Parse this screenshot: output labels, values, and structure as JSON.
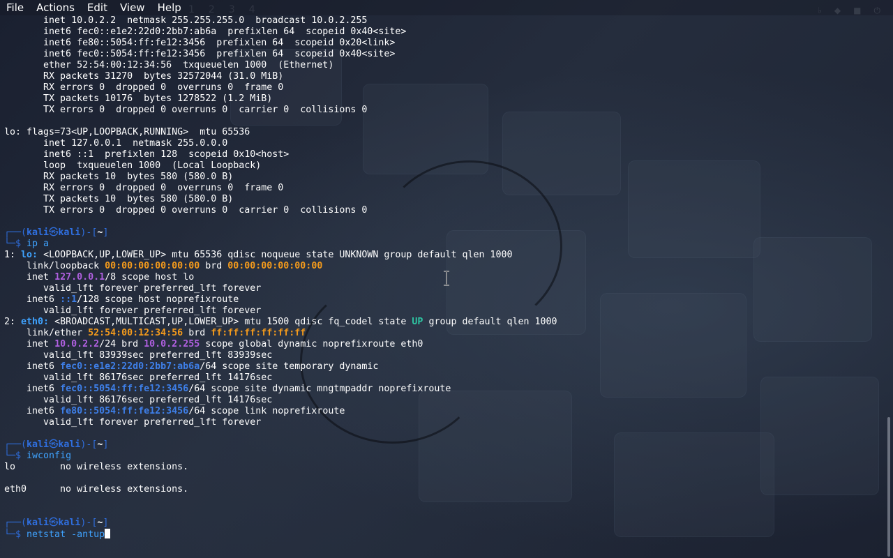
{
  "menubar": {
    "items": [
      "File",
      "Actions",
      "Edit",
      "View",
      "Help"
    ]
  },
  "prompt": {
    "user": "kali",
    "host": "kali",
    "path": "~"
  },
  "terminal": {
    "lines": [
      [
        {
          "t": "       inet 10.0.2.2  netmask 255.255.255.0  broadcast 10.0.2.255"
        }
      ],
      [
        {
          "t": "       inet6 fec0::e1e2:22d0:2bb7:ab6a  prefixlen 64  scopeid 0x40<site>"
        }
      ],
      [
        {
          "t": "       inet6 fe80::5054:ff:fe12:3456  prefixlen 64  scopeid 0x20<link>"
        }
      ],
      [
        {
          "t": "       inet6 fec0::5054:ff:fe12:3456  prefixlen 64  scopeid 0x40<site>"
        }
      ],
      [
        {
          "t": "       ether 52:54:00:12:34:56  txqueuelen 1000  (Ethernet)"
        }
      ],
      [
        {
          "t": "       RX packets 31270  bytes 32572044 (31.0 MiB)"
        }
      ],
      [
        {
          "t": "       RX errors 0  dropped 0  overruns 0  frame 0"
        }
      ],
      [
        {
          "t": "       TX packets 10176  bytes 1278522 (1.2 MiB)"
        }
      ],
      [
        {
          "t": "       TX errors 0  dropped 0 overruns 0  carrier 0  collisions 0"
        }
      ],
      [],
      [
        {
          "t": "lo: flags=73<UP,LOOPBACK,RUNNING>  mtu 65536"
        }
      ],
      [
        {
          "t": "       inet 127.0.0.1  netmask 255.0.0.0"
        }
      ],
      [
        {
          "t": "       inet6 ::1  prefixlen 128  scopeid 0x10<host>"
        }
      ],
      [
        {
          "t": "       loop  txqueuelen 1000  (Local Loopback)"
        }
      ],
      [
        {
          "t": "       RX packets 10  bytes 580 (580.0 B)"
        }
      ],
      [
        {
          "t": "       RX errors 0  dropped 0  overruns 0  frame 0"
        }
      ],
      [
        {
          "t": "       TX packets 10  bytes 580 (580.0 B)"
        }
      ],
      [
        {
          "t": "       TX errors 0  dropped 0 overruns 0  carrier 0  collisions 0"
        }
      ],
      [],
      [
        {
          "prompt": true
        }
      ],
      [
        {
          "t": "└─$ ",
          "c": "c-prompt"
        },
        {
          "t": "ip a",
          "c": "c-cmd"
        }
      ],
      [
        {
          "t": "1: "
        },
        {
          "t": "lo:",
          "c": "c-dev"
        },
        {
          "t": " <LOOPBACK,UP,LOWER_UP> mtu 65536 qdisc noqueue state UNKNOWN group default qlen 1000"
        }
      ],
      [
        {
          "t": "    link/loopback "
        },
        {
          "t": "00:00:00:00:00:00",
          "c": "c-orange"
        },
        {
          "t": " brd "
        },
        {
          "t": "00:00:00:00:00:00",
          "c": "c-orange"
        }
      ],
      [
        {
          "t": "    inet "
        },
        {
          "t": "127.0.0.1",
          "c": "c-purple"
        },
        {
          "t": "/8 scope host lo"
        }
      ],
      [
        {
          "t": "       valid_lft forever preferred_lft forever"
        }
      ],
      [
        {
          "t": "    inet6 "
        },
        {
          "t": "::1",
          "c": "c-blue"
        },
        {
          "t": "/128 scope host noprefixroute"
        }
      ],
      [
        {
          "t": "       valid_lft forever preferred_lft forever"
        }
      ],
      [
        {
          "t": "2: "
        },
        {
          "t": "eth0:",
          "c": "c-dev"
        },
        {
          "t": " <BROADCAST,MULTICAST,UP,LOWER_UP> mtu 1500 qdisc fq_codel state "
        },
        {
          "t": "UP",
          "c": "c-green"
        },
        {
          "t": " group default qlen 1000"
        }
      ],
      [
        {
          "t": "    link/ether "
        },
        {
          "t": "52:54:00:12:34:56",
          "c": "c-orange"
        },
        {
          "t": " brd "
        },
        {
          "t": "ff:ff:ff:ff:ff:ff",
          "c": "c-orange"
        }
      ],
      [
        {
          "t": "    inet "
        },
        {
          "t": "10.0.2.2",
          "c": "c-purple"
        },
        {
          "t": "/24 brd "
        },
        {
          "t": "10.0.2.255",
          "c": "c-purple"
        },
        {
          "t": " scope global dynamic noprefixroute eth0"
        }
      ],
      [
        {
          "t": "       valid_lft 83939sec preferred_lft 83939sec"
        }
      ],
      [
        {
          "t": "    inet6 "
        },
        {
          "t": "fec0::e1e2:22d0:2bb7:ab6a",
          "c": "c-blue"
        },
        {
          "t": "/64 scope site temporary dynamic"
        }
      ],
      [
        {
          "t": "       valid_lft 86176sec preferred_lft 14176sec"
        }
      ],
      [
        {
          "t": "    inet6 "
        },
        {
          "t": "fec0::5054:ff:fe12:3456",
          "c": "c-blue"
        },
        {
          "t": "/64 scope site dynamic mngtmpaddr noprefixroute"
        }
      ],
      [
        {
          "t": "       valid_lft 86176sec preferred_lft 14176sec"
        }
      ],
      [
        {
          "t": "    inet6 "
        },
        {
          "t": "fe80::5054:ff:fe12:3456",
          "c": "c-blue"
        },
        {
          "t": "/64 scope link noprefixroute"
        }
      ],
      [
        {
          "t": "       valid_lft forever preferred_lft forever"
        }
      ],
      [],
      [
        {
          "prompt": true
        }
      ],
      [
        {
          "t": "└─$ ",
          "c": "c-prompt"
        },
        {
          "t": "iwconfig",
          "c": "c-cmd"
        }
      ],
      [
        {
          "t": "lo        no wireless extensions."
        }
      ],
      [],
      [
        {
          "t": "eth0      no wireless extensions."
        }
      ],
      [],
      [],
      [
        {
          "prompt": true
        }
      ],
      [
        {
          "t": "└─$ ",
          "c": "c-prompt"
        },
        {
          "t": "netstat -antup",
          "c": "c-cmd"
        },
        {
          "cursor": true
        }
      ]
    ]
  }
}
